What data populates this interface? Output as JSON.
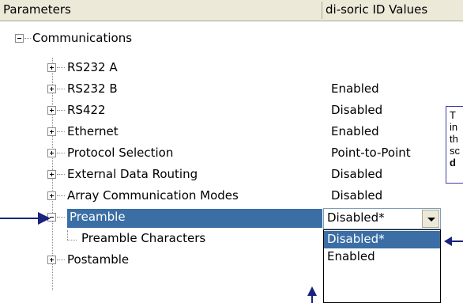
{
  "header": {
    "col_parameters": "Parameters",
    "col_values": "di-soric ID Values"
  },
  "tree": [
    {
      "label": "Communications",
      "value": ""
    },
    {
      "label": "RS232 A",
      "value": ""
    },
    {
      "label": "RS232 B",
      "value": "Enabled"
    },
    {
      "label": "RS422",
      "value": "Disabled"
    },
    {
      "label": "Ethernet",
      "value": "Enabled"
    },
    {
      "label": "Protocol Selection",
      "value": "Point-to-Point"
    },
    {
      "label": "External Data Routing",
      "value": "Disabled"
    },
    {
      "label": "Array Communication Modes",
      "value": "Disabled"
    },
    {
      "label": "Preamble",
      "value": "Disabled*"
    },
    {
      "label": "Preamble Characters",
      "value": ""
    },
    {
      "label": "Postamble",
      "value": ""
    }
  ],
  "dropdown": {
    "options": [
      "Disabled*",
      "Enabled"
    ],
    "selected_index": 0
  },
  "callout": {
    "line1": "T",
    "line2": "in",
    "line3": "th",
    "line4": "sc",
    "line5": "d"
  },
  "colors": {
    "selection": "#3a6ea5",
    "arrow": "#1a237e",
    "header_bg": "#ece9d8"
  }
}
